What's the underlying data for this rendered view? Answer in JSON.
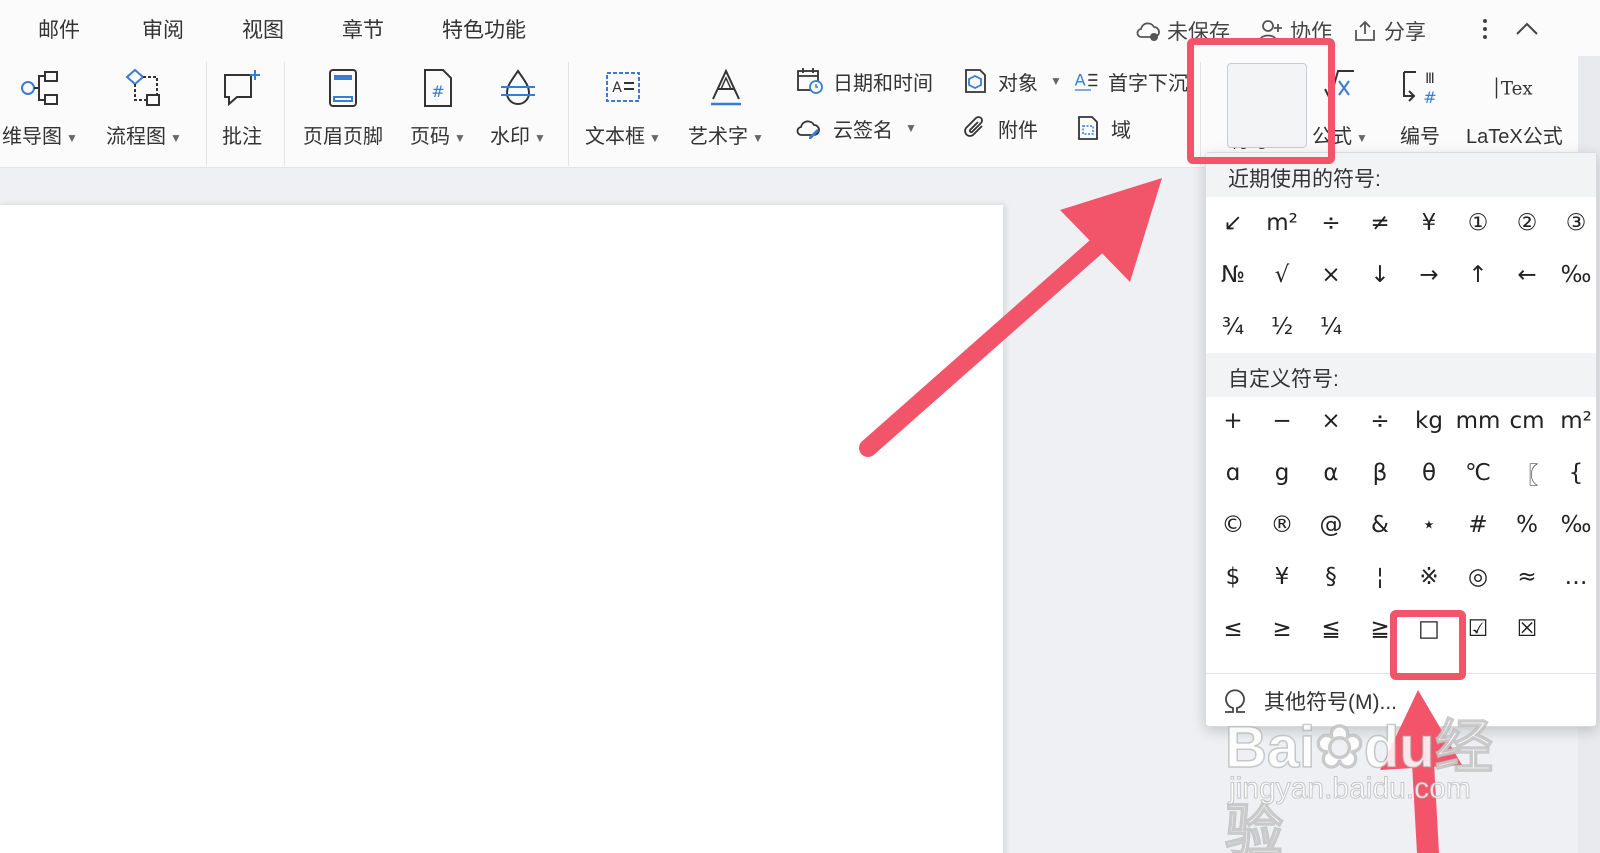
{
  "menu": {
    "tabs": [
      "邮件",
      "审阅",
      "视图",
      "章节",
      "特色功能"
    ],
    "unsaved": "未保存",
    "collab": "协作",
    "share": "分享"
  },
  "ribbon": {
    "mindmap": "维导图",
    "flowchart": "流程图",
    "comment": "批注",
    "header_footer": "页眉页脚",
    "page_number": "页码",
    "watermark": "水印",
    "textbox": "文本框",
    "wordart": "艺术字",
    "datetime": "日期和时间",
    "cloud_sign": "云签名",
    "object": "对象",
    "attachment": "附件",
    "dropcap": "首字下沉",
    "field": "域",
    "symbol": "符号",
    "formula": "公式",
    "numbering": "编号",
    "latex": "LaTeX公式"
  },
  "symbol_panel": {
    "recent_title": "近期使用的符号:",
    "recent": [
      "↙",
      "m²",
      "÷",
      "≠",
      "¥",
      "①",
      "②",
      "③",
      "№",
      "√",
      "×",
      "↓",
      "→",
      "↑",
      "←",
      "‰",
      "¾",
      "½",
      "¼"
    ],
    "custom_title": "自定义符号:",
    "custom": [
      "+",
      "−",
      "×",
      "÷",
      "kg",
      "mm",
      "cm",
      "m²",
      "ɑ",
      "g",
      "α",
      "β",
      "θ",
      "℃",
      "〖",
      "{",
      "©",
      "®",
      "@",
      "&",
      "⋆",
      "#",
      "%",
      "‰",
      "$",
      "¥",
      "§",
      "¦",
      "※",
      "◎",
      "≈",
      "…",
      "≤",
      "≥",
      "≦",
      "≧",
      "□",
      "☑",
      "☒"
    ],
    "more": "其他符号(M)..."
  },
  "watermark": {
    "brand": "Bai",
    "brand2": "du",
    "cn": "经验",
    "url": "jingyan.baidu.com"
  },
  "colors": {
    "highlight": "#f2556a",
    "accent_blue": "#3a7bd5"
  }
}
